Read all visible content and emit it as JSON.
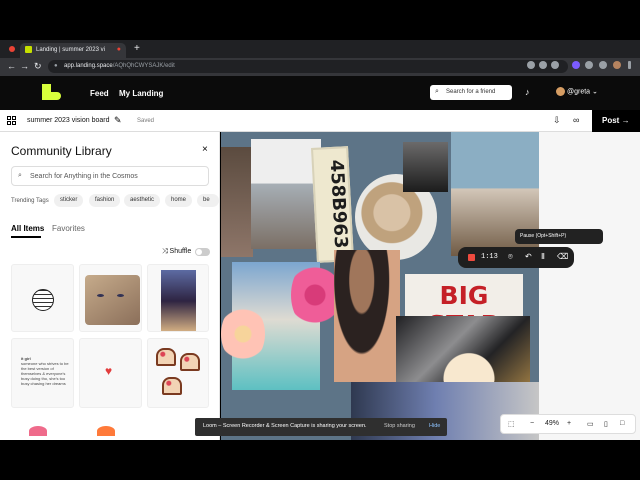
{
  "browser": {
    "tab_title": "Landing | summer 2023 vi",
    "address_host": "app.landing.space",
    "address_path": "/AQhQhCWYSAJK/edit",
    "new_tab_icon": "plus-icon"
  },
  "app": {
    "nav": [
      "Feed",
      "My Landing"
    ],
    "search_placeholder": "Search for a friend",
    "username": "@greta",
    "brand_color": "#d8ff3c"
  },
  "document": {
    "title": "summer 2023 vision board",
    "status": "Saved",
    "post_label": "Post"
  },
  "library": {
    "title": "Community Library",
    "search_placeholder": "Search for Anything in the Cosmos",
    "trending_label": "Trending Tags",
    "tags": [
      "sticker",
      "fashion",
      "aesthetic",
      "home",
      "be"
    ],
    "tabs": [
      "All Items",
      "Favorites"
    ],
    "shuffle_label": "Shuffle",
    "quote_title": "it girl",
    "quote_text": "someone who strives to be the best version of themselves & everyone's busy doing tho, she's too busy chasing her dreams"
  },
  "canvas": {
    "plate_text": "458B963",
    "sign_text": "BIG STAR"
  },
  "recorder": {
    "time": "1:13",
    "tooltip": "Pause (Opt+Shift+P)"
  },
  "loom": {
    "message": "Loom – Screen Recorder & Screen Capture is sharing your screen.",
    "stop_label": "Stop sharing",
    "hide_label": "Hide"
  },
  "zoom": {
    "level": "49%"
  }
}
